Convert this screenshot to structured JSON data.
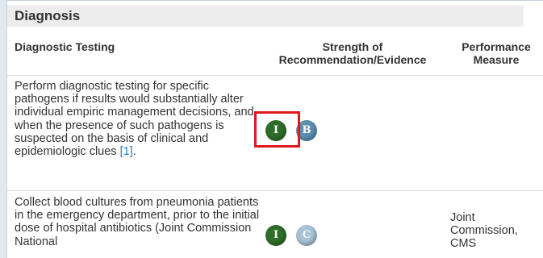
{
  "section": {
    "title": "Diagnosis"
  },
  "columns": {
    "test": "Diagnostic Testing",
    "strength": "Strength of Recommendation/Evidence",
    "measure": "Performance Measure"
  },
  "rows": [
    {
      "text": "Perform diagnostic testing for specific pathogens if results would substantially alter individual empiric management decisions, and when the presence of such pathogens is suspected on the basis of clinical and epidemiologic clues",
      "reference": "[1]",
      "trailing": ".",
      "strength": "I",
      "evidence": "B",
      "measure": ""
    },
    {
      "text": "Collect blood cultures from pneumonia patients in the emergency department, prior to the initial dose of hospital antibiotics (Joint Commission National",
      "reference": "",
      "trailing": "",
      "strength": "I",
      "evidence": "C",
      "measure": "Joint Commission, CMS"
    }
  ],
  "colors": {
    "strength_badge": "#2f6e2a",
    "evidence_b_badge": "#5a8fb2",
    "evidence_c_badge": "#a7c2d6",
    "highlight": "#e0161b",
    "link": "#2a7ab8"
  }
}
